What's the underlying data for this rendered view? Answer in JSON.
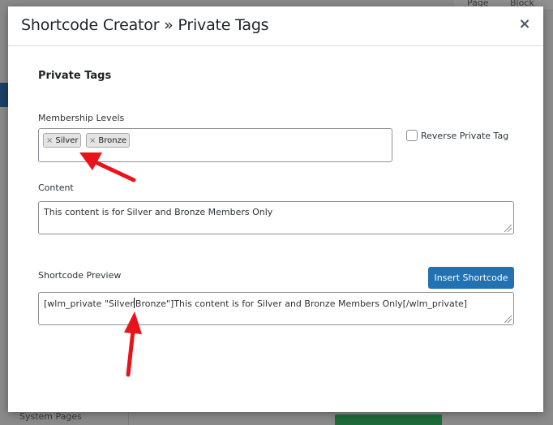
{
  "background": {
    "top_items": [
      "Page",
      "Block"
    ],
    "bottom_item": "System Pages"
  },
  "modal": {
    "title": "Shortcode Creator » Private Tags",
    "section_title": "Private Tags",
    "membership_levels": {
      "label": "Membership Levels",
      "tags": [
        "Silver",
        "Bronze"
      ],
      "remove_glyph": "×"
    },
    "reverse_private_tag": {
      "label": "Reverse Private Tag",
      "checked": false
    },
    "content": {
      "label": "Content",
      "value": "This content is for Silver and Bronze Members Only"
    },
    "shortcode_preview": {
      "label": "Shortcode Preview",
      "value_before_caret": "[wlm_private \"Silver",
      "value_after_caret": "Bronze\"]This content is for Silver and Bronze Members Only[/wlm_private]"
    },
    "insert_button": "Insert Shortcode",
    "close_glyph": "×"
  },
  "colors": {
    "primary_button": "#2271b1",
    "annotation_arrow": "#e8141b"
  }
}
